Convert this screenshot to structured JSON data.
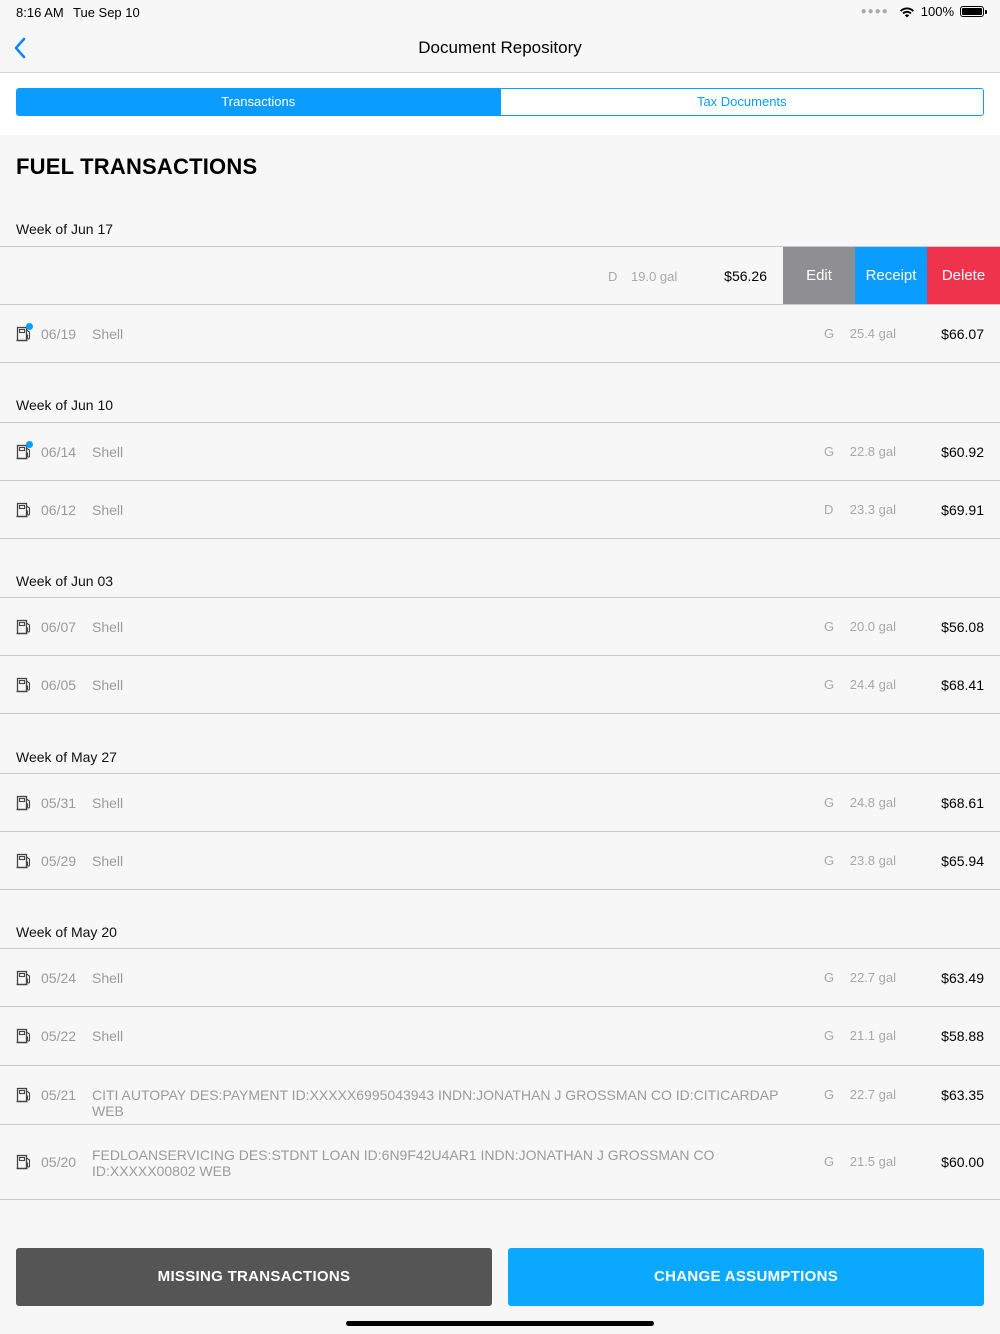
{
  "status": {
    "time": "8:16 AM",
    "date": "Tue Sep 10",
    "battery": "100%"
  },
  "nav": {
    "title": "Document Repository"
  },
  "tabs": [
    {
      "label": "Transactions",
      "active": true
    },
    {
      "label": "Tax Documents",
      "active": false
    }
  ],
  "section_title": "FUEL TRANSACTIONS",
  "weeks": [
    "Week of Jun 17",
    "Week of Jun 10",
    "Week of Jun 03",
    "Week of May 27",
    "Week of May 20"
  ],
  "swiped": {
    "type": "D",
    "gallons": "19.0 gal",
    "amount": "$56.26",
    "edit": "Edit",
    "receipt": "Receipt",
    "delete": "Delete"
  },
  "transactions": [
    {
      "date": "06/19",
      "merchant": "Shell",
      "type": "G",
      "gallons": "25.4 gal",
      "amount": "$66.07"
    },
    {
      "date": "06/14",
      "merchant": "Shell",
      "type": "G",
      "gallons": "22.8 gal",
      "amount": "$60.92"
    },
    {
      "date": "06/12",
      "merchant": "Shell",
      "type": "D",
      "gallons": "23.3 gal",
      "amount": "$69.91"
    },
    {
      "date": "06/07",
      "merchant": "Shell",
      "type": "G",
      "gallons": "20.0 gal",
      "amount": "$56.08"
    },
    {
      "date": "06/05",
      "merchant": "Shell",
      "type": "G",
      "gallons": "24.4 gal",
      "amount": "$68.41"
    },
    {
      "date": "05/31",
      "merchant": "Shell",
      "type": "G",
      "gallons": "24.8 gal",
      "amount": "$68.61"
    },
    {
      "date": "05/29",
      "merchant": "Shell",
      "type": "G",
      "gallons": "23.8 gal",
      "amount": "$65.94"
    },
    {
      "date": "05/24",
      "merchant": "Shell",
      "type": "G",
      "gallons": "22.7 gal",
      "amount": "$63.49"
    },
    {
      "date": "05/22",
      "merchant": "Shell",
      "type": "G",
      "gallons": "21.1 gal",
      "amount": "$58.88"
    },
    {
      "date": "05/21",
      "merchant": "CITI AUTOPAY DES:PAYMENT ID:XXXXX6995043943 INDN:JONATHAN J GROSSMAN CO ID:CITICARDAP WEB",
      "type": "G",
      "gallons": "22.7 gal",
      "amount": "$63.35"
    },
    {
      "date": "05/20",
      "merchant": "FEDLOANSERVICING DES:STDNT LOAN ID:6N9F42U4AR1 INDN:JONATHAN J GROSSMAN CO ID:XXXXX00802 WEB",
      "type": "G",
      "gallons": "21.5 gal",
      "amount": "$60.00"
    }
  ],
  "buttons": {
    "missing": "MISSING TRANSACTIONS",
    "change": "CHANGE ASSUMPTIONS"
  }
}
